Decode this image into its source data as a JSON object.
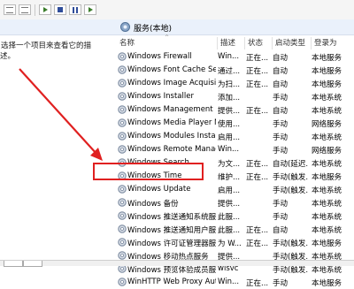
{
  "header": {
    "title": "服务(本地)"
  },
  "description": {
    "text": "选择一个项目来查看它的描述。"
  },
  "columns": [
    "名称",
    "描述",
    "状态",
    "启动类型",
    "登录为"
  ],
  "services": [
    {
      "name": "Windows Firewall",
      "desc": "Win...",
      "status": "正在...",
      "startup": "自动",
      "logon": "本地服务"
    },
    {
      "name": "Windows Font Cache Ser...",
      "desc": "通过...",
      "status": "正在...",
      "startup": "自动",
      "logon": "本地服务"
    },
    {
      "name": "Windows Image Acquisiti...",
      "desc": "为扫...",
      "status": "正在...",
      "startup": "自动",
      "logon": "本地服务"
    },
    {
      "name": "Windows Installer",
      "desc": "添加...",
      "status": "",
      "startup": "手动",
      "logon": "本地系统"
    },
    {
      "name": "Windows Management I...",
      "desc": "提供...",
      "status": "正在...",
      "startup": "自动",
      "logon": "本地系统"
    },
    {
      "name": "Windows Media Player N...",
      "desc": "使用...",
      "status": "",
      "startup": "手动",
      "logon": "网络服务"
    },
    {
      "name": "Windows Modules Install...",
      "desc": "启用...",
      "status": "",
      "startup": "手动",
      "logon": "本地系统"
    },
    {
      "name": "Windows Remote Manag...",
      "desc": "Win...",
      "status": "",
      "startup": "手动",
      "logon": "网络服务"
    },
    {
      "name": "Windows Search",
      "desc": "为文...",
      "status": "正在...",
      "startup": "自动(延迟...",
      "logon": "本地系统"
    },
    {
      "name": "Windows Time",
      "desc": "维护...",
      "status": "正在...",
      "startup": "手动(触发...",
      "logon": "本地服务"
    },
    {
      "name": "Windows Update",
      "desc": "启用...",
      "status": "",
      "startup": "手动(触发...",
      "logon": "本地系统"
    },
    {
      "name": "Windows 备份",
      "desc": "提供...",
      "status": "",
      "startup": "手动",
      "logon": "本地系统"
    },
    {
      "name": "Windows 推送通知系统服务",
      "desc": "此服...",
      "status": "",
      "startup": "手动",
      "logon": "本地系统"
    },
    {
      "name": "Windows 推送通知用户服务...",
      "desc": "此服...",
      "status": "正在...",
      "startup": "自动",
      "logon": "本地系统"
    },
    {
      "name": "Windows 许可证管理器服务",
      "desc": "为 W...",
      "status": "正在...",
      "startup": "手动(触发...",
      "logon": "本地服务"
    },
    {
      "name": "Windows 移动热点服务",
      "desc": "提供...",
      "status": "",
      "startup": "手动(触发...",
      "logon": "本地系统"
    },
    {
      "name": "Windows 预览体验成员服务",
      "desc": "wisvc",
      "status": "",
      "startup": "手动(触发...",
      "logon": "本地系统"
    },
    {
      "name": "WinHTTP Web Proxy Aut...",
      "desc": "Win...",
      "status": "正在...",
      "startup": "手动",
      "logon": "本地服务"
    }
  ],
  "colors": {
    "highlight": "#e02020",
    "arrow": "#e02020",
    "header_bg": "#eaf1fb"
  },
  "icons": {
    "service": "gear-icon",
    "header": "services-icon"
  }
}
